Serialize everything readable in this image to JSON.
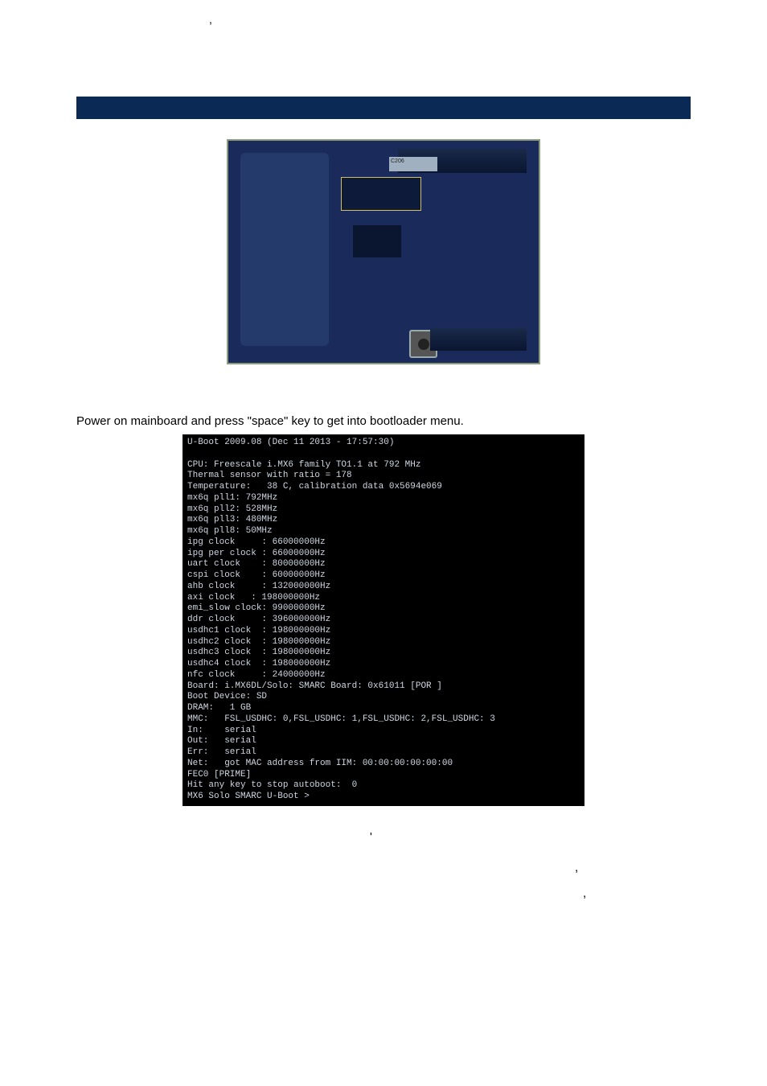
{
  "instruction": "Power on mainboard and press \"space\" key to get into bootloader menu.",
  "photo": {
    "label_text": "C206"
  },
  "terminal": {
    "lines": [
      "U-Boot 2009.08 (Dec 11 2013 - 17:57:30)",
      "",
      "CPU: Freescale i.MX6 family TO1.1 at 792 MHz",
      "Thermal sensor with ratio = 178",
      "Temperature:   38 C, calibration data 0x5694e069",
      "mx6q pll1: 792MHz",
      "mx6q pll2: 528MHz",
      "mx6q pll3: 480MHz",
      "mx6q pll8: 50MHz",
      "ipg clock     : 66000000Hz",
      "ipg per clock : 66000000Hz",
      "uart clock    : 80000000Hz",
      "cspi clock    : 60000000Hz",
      "ahb clock     : 132000000Hz",
      "axi clock   : 198000000Hz",
      "emi_slow clock: 99000000Hz",
      "ddr clock     : 396000000Hz",
      "usdhc1 clock  : 198000000Hz",
      "usdhc2 clock  : 198000000Hz",
      "usdhc3 clock  : 198000000Hz",
      "usdhc4 clock  : 198000000Hz",
      "nfc clock     : 24000000Hz",
      "Board: i.MX6DL/Solo: SMARC Board: 0x61011 [POR ]",
      "Boot Device: SD",
      "DRAM:   1 GB",
      "MMC:   FSL_USDHC: 0,FSL_USDHC: 1,FSL_USDHC: 2,FSL_USDHC: 3",
      "In:    serial",
      "Out:   serial",
      "Err:   serial",
      "Net:   got MAC address from IIM: 00:00:00:00:00:00",
      "FEC0 [PRIME]",
      "Hit any key to stop autoboot:  0",
      "MX6 Solo SMARC U-Boot >"
    ]
  },
  "punct": {
    "header": ",",
    "f1": "'",
    "f2": ",",
    "f3": ","
  }
}
